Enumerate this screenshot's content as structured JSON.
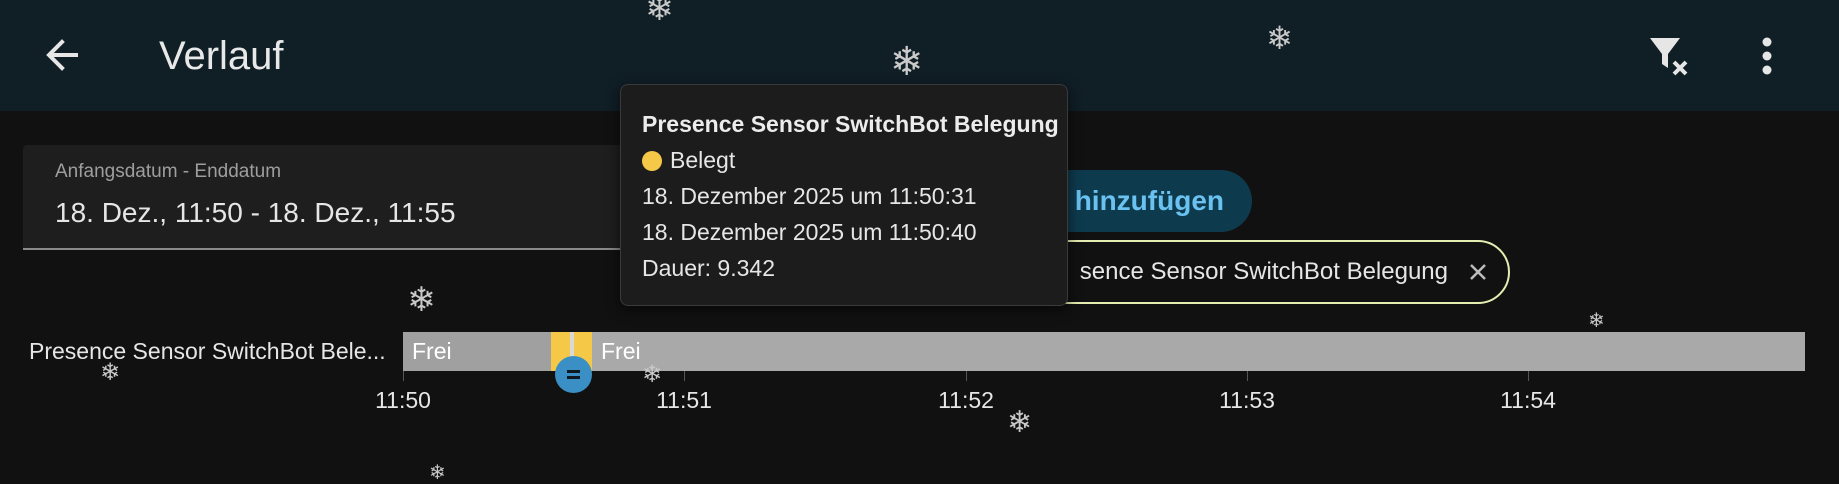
{
  "header": {
    "title": "Verlauf",
    "back_icon": "arrow-left-icon",
    "filter_clear_icon": "filter-remove-icon",
    "menu_icon": "dots-vertical-icon"
  },
  "date_range": {
    "label": "Anfangsdatum - Enddatum",
    "value": "18. Dez., 11:50 - 18. Dez., 11:55"
  },
  "add_target": {
    "label": "el hinzufügen"
  },
  "target_chip": {
    "label": "sence Sensor SwitchBot Belegung",
    "close_icon": "close-icon"
  },
  "timeline": {
    "entity_label": "Presence Sensor SwitchBot Bele...",
    "segments": [
      {
        "label": "Frei",
        "state": "off"
      },
      {
        "label": "",
        "state": "on"
      },
      {
        "label": "Frei",
        "state": "off"
      }
    ],
    "ticks": [
      "11:50",
      "11:51",
      "11:52",
      "11:53",
      "11:54"
    ],
    "marker_icon": "equals-icon"
  },
  "tooltip": {
    "title": "Presence Sensor SwitchBot Belegung",
    "state": "Belegt",
    "start": "18. Dezember 2025 um 11:50:31",
    "end": "18. Dezember 2025 um 11:50:40",
    "duration": "Dauer: 9.342"
  },
  "colors": {
    "header_bg": "#101e26",
    "page_bg": "#111111",
    "occupied": "#f5c947",
    "free": "#a9a9a9",
    "accent": "#6ac2f0",
    "chip_border": "#e6edb0"
  },
  "decor": {
    "snowflake_glyph": "❄"
  }
}
